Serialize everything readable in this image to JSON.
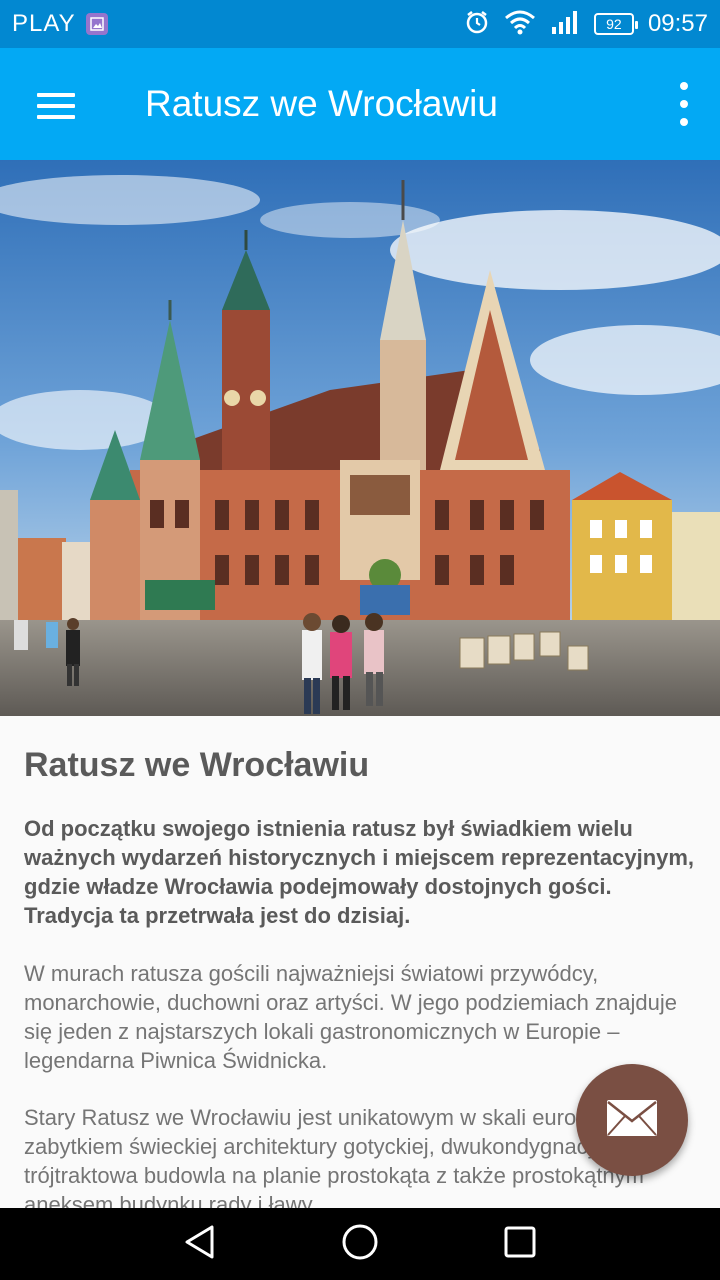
{
  "status_bar": {
    "carrier": "PLAY",
    "battery": "92",
    "time": "09:57"
  },
  "app_bar": {
    "title": "Ratusz we Wrocławiu",
    "color": "#03a9f4"
  },
  "hero_image": {
    "subject": "Gothic town hall on market square"
  },
  "article": {
    "heading": "Ratusz we Wrocławiu",
    "lead": "Od początku swojego istnienia ratusz był świadkiem wielu ważnych wydarzeń historycznych i miejscem reprezentacyjnym, gdzie władze Wrocławia podejmowały dostojnych gości. Tradycja ta przetrwała jest do dzisiaj.",
    "paragraph_1": "W murach ratusza gościli najważniejsi światowi przywódcy, monarchowie, duchowni oraz artyści. W jego podziemiach znajduje się jeden z najstarszych lokali gastronomicznych w Europie – legendarna Piwnica Świdnicka.",
    "paragraph_2": "Stary Ratusz we Wrocławiu jest unikatowym w skali europejskiej zabytkiem świeckiej architektury gotyckiej, dwukondygnacyjna, trójtraktowa budowla na planie prostokąta z także prostokątnym aneksem budynku rady i ławy."
  },
  "fab": {
    "icon": "mail-icon",
    "color": "#7a4f43"
  },
  "nav_bar": {
    "back_icon": "back-icon",
    "home_icon": "home-icon",
    "recents_icon": "recents-icon"
  }
}
